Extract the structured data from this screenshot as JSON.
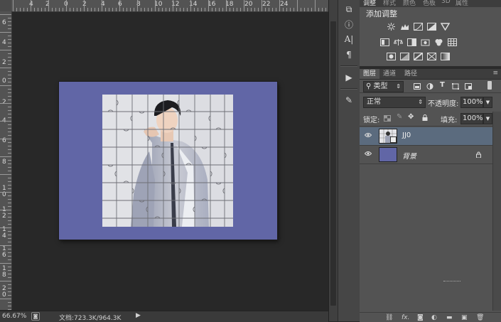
{
  "ruler": {
    "top_labels": [
      "6",
      "4",
      "2",
      "0",
      "2",
      "4",
      "6",
      "8",
      "10",
      "12",
      "14",
      "16",
      "18",
      "20",
      "22",
      "24"
    ],
    "left_labels": [
      "6",
      "4",
      "2",
      "0",
      "2",
      "4",
      "6",
      "8",
      "1\n0",
      "1\n2",
      "1\n4",
      "1\n6",
      "1\n8",
      "2\n0"
    ]
  },
  "status": {
    "zoom": "66.67%",
    "doc_info": "文档:723.3K/964.3K"
  },
  "adjustments_panel": {
    "tabs": [
      "调整",
      "样式",
      "颜色",
      "色板",
      "3D",
      "属性"
    ],
    "title": "添加调整"
  },
  "layers_panel": {
    "tabs": [
      "图层",
      "通道",
      "路径"
    ],
    "filter_kind": "类型",
    "blend_mode": "正常",
    "opacity_label": "不透明度:",
    "opacity_value": "100%",
    "lock_label": "锁定:",
    "fill_label": "填充:",
    "fill_value": "100%",
    "layers": [
      {
        "name": "JJ0",
        "selected": true,
        "locked": false
      },
      {
        "name": "背景",
        "selected": false,
        "locked": true
      }
    ],
    "footer_icons": [
      "link-icon",
      "fx-icon",
      "mask-icon",
      "adjustment-icon",
      "group-icon",
      "new-layer-icon",
      "trash-icon"
    ]
  },
  "colors": {
    "canvas_bg": "#6166a6",
    "panel_bg": "#535353",
    "selected_layer": "#5b6b7e"
  }
}
